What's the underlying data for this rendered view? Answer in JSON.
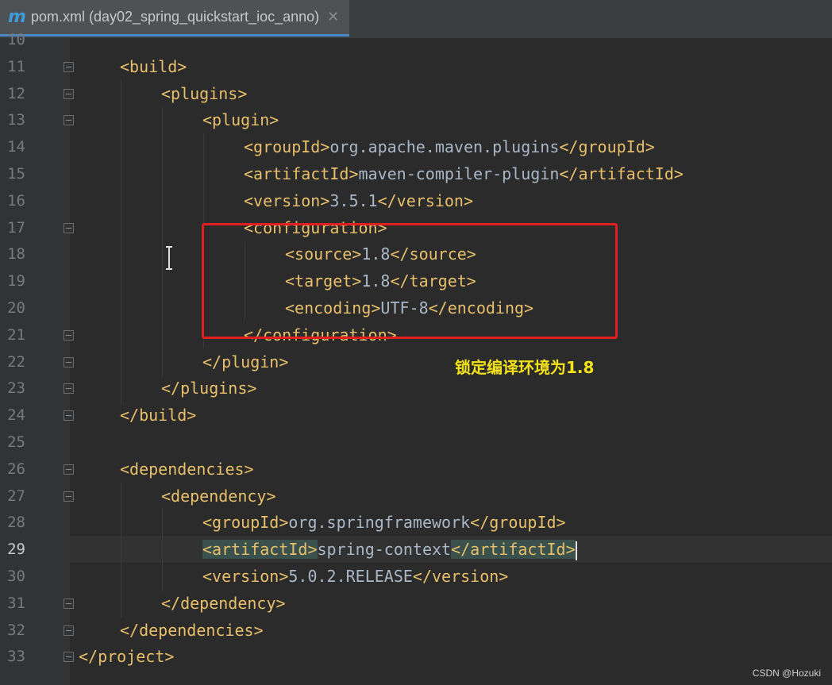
{
  "tab": {
    "icon": "m",
    "title": "pom.xml (day02_spring_quickstart_ioc_anno)",
    "close": "✕"
  },
  "annotation": {
    "note": "锁定编译环境为1.8",
    "watermark": "CSDN @Hozuki"
  },
  "lines": [
    {
      "n": "10",
      "code": ""
    },
    {
      "n": "11",
      "code": "<build>"
    },
    {
      "n": "12",
      "code": "<plugins>"
    },
    {
      "n": "13",
      "code": "<plugin>"
    },
    {
      "n": "14",
      "tag_open": "<groupId>",
      "value": "org.apache.maven.plugins",
      "tag_close": "</groupId>"
    },
    {
      "n": "15",
      "tag_open": "<artifactId>",
      "value": "maven-compiler-plugin",
      "tag_close": "</artifactId>"
    },
    {
      "n": "16",
      "tag_open": "<version>",
      "value": "3.5.1",
      "tag_close": "</version>"
    },
    {
      "n": "17",
      "code": "<configuration>"
    },
    {
      "n": "18",
      "tag_open": "<source>",
      "value": "1.8",
      "tag_close": "</source>"
    },
    {
      "n": "19",
      "tag_open": "<target>",
      "value": "1.8",
      "tag_close": "</target>"
    },
    {
      "n": "20",
      "tag_open": "<encoding>",
      "value": "UTF-8",
      "tag_close": "</encoding>"
    },
    {
      "n": "21",
      "code": "</configuration>"
    },
    {
      "n": "22",
      "code": "</plugin>"
    },
    {
      "n": "23",
      "code": "</plugins>"
    },
    {
      "n": "24",
      "code": "</build>"
    },
    {
      "n": "25",
      "code": ""
    },
    {
      "n": "26",
      "code": "<dependencies>"
    },
    {
      "n": "27",
      "code": "<dependency>"
    },
    {
      "n": "28",
      "tag_open": "<groupId>",
      "value": "org.springframework",
      "tag_close": "</groupId>"
    },
    {
      "n": "29",
      "tag_open": "<artifactId>",
      "value": "spring-context",
      "tag_close": "</artifactId>"
    },
    {
      "n": "30",
      "tag_open": "<version>",
      "value": "5.0.2.RELEASE",
      "tag_close": "</version>"
    },
    {
      "n": "31",
      "code": "</dependency>"
    },
    {
      "n": "32",
      "code": "</dependencies>"
    },
    {
      "n": "33",
      "code": "</project>"
    }
  ],
  "colors": {
    "tag": "#e8bf6a",
    "text": "#a9b7c6",
    "background": "#2b2b2b",
    "highlight_box": "#e02020",
    "note": "#f3e21a"
  }
}
